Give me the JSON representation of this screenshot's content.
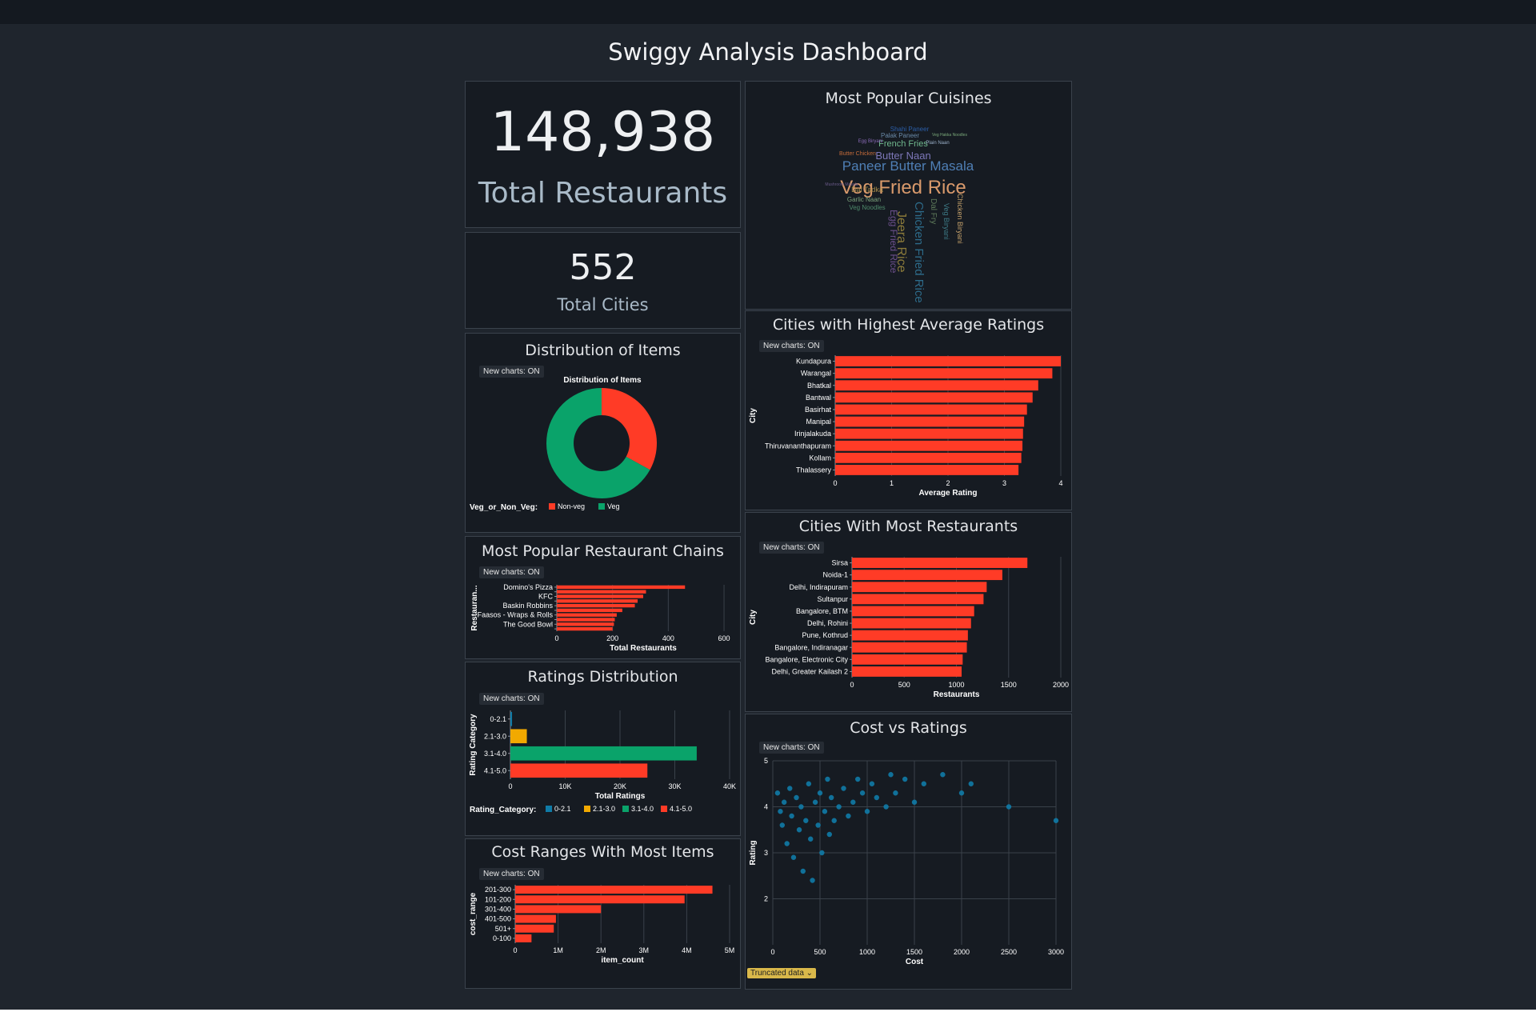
{
  "dashboard": {
    "title": "Swiggy Analysis Dashboard"
  },
  "badge_text": "New charts: ON",
  "truncated_label": "Truncated data ⌄",
  "kpi": {
    "restaurants": {
      "value": "148,938",
      "label": "Total Restaurants"
    },
    "cities": {
      "value": "552",
      "label": "Total Cities"
    }
  },
  "panels": {
    "items": "Distribution of Items",
    "chains": "Most Popular Restaurant Chains",
    "ratings": "Ratings Distribution",
    "cost_ranges": "Cost Ranges With Most Items",
    "cuisines": "Most Popular Cuisines",
    "top_cities": "Cities with Highest Average Ratings",
    "most_cities": "Cities With Most Restaurants",
    "cost_ratings": "Cost vs Ratings"
  },
  "wordcloud": {
    "words": [
      {
        "text": "Veg Fried Rice",
        "color": "#d99a6c",
        "size": 24
      },
      {
        "text": "Paneer Butter Masala",
        "color": "#4f7fb5",
        "size": 17
      },
      {
        "text": "Butter Naan",
        "color": "#7d77b8",
        "size": 13
      },
      {
        "text": "French Fries",
        "color": "#70b88e",
        "size": 11
      },
      {
        "text": "Jeera Rice",
        "color": "#8a7a3a",
        "size": 16,
        "rotate": true
      },
      {
        "text": "Chicken Fried Rice",
        "color": "#2d6b8a",
        "size": 15,
        "rotate": true
      },
      {
        "text": "Egg Fried Rice",
        "color": "#6b4f8a",
        "size": 12,
        "rotate": true
      },
      {
        "text": "Dal Fry",
        "color": "#5e7a5a",
        "size": 10,
        "rotate": true
      },
      {
        "text": "Veg Biryani",
        "color": "#3d7a86",
        "size": 9,
        "rotate": true
      },
      {
        "text": "Dal Tadka",
        "color": "#a58a4a",
        "size": 9
      },
      {
        "text": "Garlic Naan",
        "color": "#7aa07a",
        "size": 8
      },
      {
        "text": "Veg Noodles",
        "color": "#4f8a6b",
        "size": 8
      },
      {
        "text": "Palak Paneer",
        "color": "#6a8aa8",
        "size": 8
      },
      {
        "text": "Shahi Paneer",
        "color": "#2b5ea8",
        "size": 8
      },
      {
        "text": "Butter Chicken",
        "color": "#c46b3a",
        "size": 7
      },
      {
        "text": "Egg Biryani",
        "color": "#8a6ab8",
        "size": 6
      },
      {
        "text": "Plain Naan",
        "color": "#9ab0c8",
        "size": 6
      },
      {
        "text": "Veg Hakka Noodles",
        "color": "#7aa87a",
        "size": 5
      },
      {
        "text": "Chicken Biryani",
        "color": "#c4a06a",
        "size": 9,
        "rotate": true
      },
      {
        "text": "Mushroom Masala",
        "color": "#6a5a8a",
        "size": 5
      }
    ]
  },
  "chart_data": [
    {
      "id": "items_donut",
      "type": "pie",
      "title": "Distribution of Items",
      "legend_title": "Veg_or_Non_Veg:",
      "slices": [
        {
          "label": "Non-veg",
          "value": 0.33,
          "color": "#ff3b26"
        },
        {
          "label": "Veg",
          "value": 0.67,
          "color": "#0aa36a"
        }
      ]
    },
    {
      "id": "chains",
      "type": "bar",
      "xlabel": "Total Restaurants",
      "ylabel": "Restauran...",
      "categories": [
        "Domino's Pizza",
        "",
        "KFC",
        "",
        "Baskin Robbins",
        "",
        "Faasos - Wraps & Rolls",
        "",
        "The Good Bowl",
        ""
      ],
      "values": [
        460,
        320,
        310,
        290,
        280,
        235,
        215,
        208,
        205,
        200
      ],
      "ticks": [
        0,
        200,
        400,
        600
      ],
      "xlim": [
        0,
        620
      ],
      "color": "#ff3b26"
    },
    {
      "id": "ratings",
      "type": "bar",
      "xlabel": "Total Ratings",
      "ylabel": "Rating Category",
      "categories": [
        "0-2.1",
        "2.1-3.0",
        "3.1-4.0",
        "4.1-5.0"
      ],
      "values": [
        300,
        3000,
        34000,
        25000
      ],
      "colors": [
        "#0f7ba7",
        "#f2a900",
        "#0aa36a",
        "#ff3b26"
      ],
      "ticks": [
        0,
        10000,
        20000,
        30000,
        40000
      ],
      "tick_labels": [
        "0",
        "10K",
        "20K",
        "30K",
        "40K"
      ],
      "xlim": [
        0,
        40000
      ],
      "legend_title": "Rating_Category:"
    },
    {
      "id": "cost_ranges",
      "type": "bar",
      "xlabel": "item_count",
      "ylabel": "cost_range",
      "categories": [
        "201-300",
        "101-200",
        "301-400",
        "401-500",
        "501+",
        "0-100"
      ],
      "values": [
        4600000,
        3950000,
        2000000,
        950000,
        900000,
        380000
      ],
      "ticks": [
        0,
        1000000,
        2000000,
        3000000,
        4000000,
        5000000
      ],
      "tick_labels": [
        "0",
        "1M",
        "2M",
        "3M",
        "4M",
        "5M"
      ],
      "xlim": [
        0,
        5000000
      ],
      "color": "#ff3b26"
    },
    {
      "id": "top_cities",
      "type": "bar",
      "xlabel": "Average Rating",
      "ylabel": "City",
      "categories": [
        "Kundapura",
        "Warangal",
        "Bhatkal",
        "Bantwal",
        "Basirhat",
        "Manipal",
        "Irinjalakuda",
        "Thiruvananthapuram",
        "Kollam",
        "Thalassery"
      ],
      "values": [
        4.0,
        3.85,
        3.6,
        3.5,
        3.4,
        3.35,
        3.33,
        3.32,
        3.3,
        3.25
      ],
      "ticks": [
        0,
        1,
        2,
        3,
        4
      ],
      "xlim": [
        0,
        4
      ],
      "color": "#ff3b26"
    },
    {
      "id": "most_cities",
      "type": "bar",
      "xlabel": "Restaurants",
      "ylabel": "City",
      "categories": [
        "Sirsa",
        "Noida-1",
        "Delhi, Indirapuram",
        "Sultanpur",
        "Bangalore, BTM",
        "Delhi, Rohini",
        "Pune, Kothrud",
        "Bangalore, Indiranagar",
        "Bangalore, Electronic City",
        "Delhi, Greater Kailash 2"
      ],
      "values": [
        1680,
        1440,
        1290,
        1260,
        1170,
        1140,
        1110,
        1100,
        1060,
        1050
      ],
      "ticks": [
        0,
        500,
        1000,
        1500,
        2000
      ],
      "xlim": [
        0,
        2000
      ],
      "color": "#ff3b26"
    },
    {
      "id": "cost_ratings",
      "type": "scatter",
      "xlabel": "Cost",
      "ylabel": "Rating",
      "xticks": [
        0,
        500,
        1000,
        1500,
        2000,
        2500,
        3000
      ],
      "yticks": [
        2,
        3,
        4,
        5
      ],
      "xlim": [
        0,
        3000
      ],
      "ylim": [
        1,
        5
      ],
      "color": "#0f7ba7",
      "points": [
        [
          50,
          4.3
        ],
        [
          80,
          3.9
        ],
        [
          100,
          3.6
        ],
        [
          120,
          4.1
        ],
        [
          150,
          3.2
        ],
        [
          180,
          4.4
        ],
        [
          200,
          3.8
        ],
        [
          220,
          2.9
        ],
        [
          250,
          4.2
        ],
        [
          280,
          3.5
        ],
        [
          300,
          4.0
        ],
        [
          320,
          2.6
        ],
        [
          350,
          3.7
        ],
        [
          380,
          4.5
        ],
        [
          400,
          3.3
        ],
        [
          420,
          2.4
        ],
        [
          450,
          4.1
        ],
        [
          480,
          3.6
        ],
        [
          500,
          4.3
        ],
        [
          520,
          3.0
        ],
        [
          550,
          3.9
        ],
        [
          580,
          4.6
        ],
        [
          600,
          3.4
        ],
        [
          620,
          4.2
        ],
        [
          650,
          3.7
        ],
        [
          700,
          4.0
        ],
        [
          750,
          4.4
        ],
        [
          800,
          3.8
        ],
        [
          850,
          4.1
        ],
        [
          900,
          4.6
        ],
        [
          950,
          4.3
        ],
        [
          1000,
          3.9
        ],
        [
          1050,
          4.5
        ],
        [
          1100,
          4.2
        ],
        [
          1200,
          4.0
        ],
        [
          1250,
          4.7
        ],
        [
          1300,
          4.3
        ],
        [
          1400,
          4.6
        ],
        [
          1500,
          4.1
        ],
        [
          1600,
          4.5
        ],
        [
          1800,
          4.7
        ],
        [
          2000,
          4.3
        ],
        [
          2100,
          4.5
        ],
        [
          2500,
          4.0
        ],
        [
          3000,
          3.7
        ]
      ]
    }
  ]
}
